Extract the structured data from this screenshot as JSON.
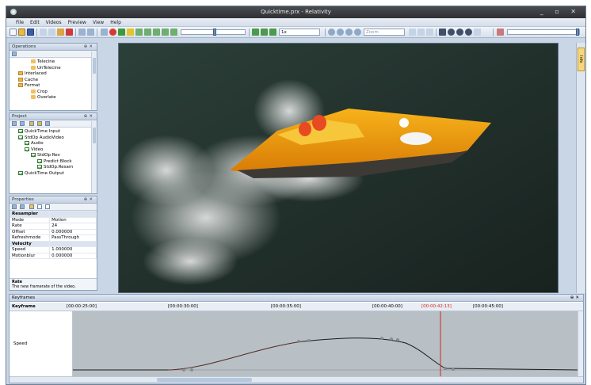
{
  "window": {
    "title": "Quicktime.prx - Relativity"
  },
  "menu": [
    "File",
    "Edit",
    "Videos",
    "Preview",
    "View",
    "Help"
  ],
  "toolbar": {
    "frame_field": "1x",
    "zoom_field": "Zoom"
  },
  "operations_panel": {
    "title": "Operations",
    "items": [
      {
        "label": "Telecine",
        "indent": 3
      },
      {
        "label": "UnTelecine",
        "indent": 3
      },
      {
        "label": "Interlaced",
        "indent": 1
      },
      {
        "label": "Cache",
        "indent": 1
      },
      {
        "label": "Format",
        "indent": 1
      },
      {
        "label": "Crop",
        "indent": 3
      },
      {
        "label": "Overlate",
        "indent": 3
      }
    ]
  },
  "project_panel": {
    "title": "Project",
    "items": [
      {
        "label": "QuickTime Input",
        "indent": 1
      },
      {
        "label": "StdOp AudioVideo",
        "indent": 1
      },
      {
        "label": "Audio",
        "indent": 2
      },
      {
        "label": "Video",
        "indent": 2
      },
      {
        "label": "StdOp Rev",
        "indent": 3
      },
      {
        "label": "Predict Block",
        "indent": 4
      },
      {
        "label": "StdOp.Resam",
        "indent": 4
      },
      {
        "label": "QuickTime Output",
        "indent": 1
      }
    ]
  },
  "properties_panel": {
    "title": "Properties",
    "rows": [
      {
        "type": "cat",
        "name": "Resampler",
        "value": ""
      },
      {
        "type": "row",
        "name": "Mode",
        "value": "Motion"
      },
      {
        "type": "sel",
        "name": "Rate",
        "value": "24"
      },
      {
        "type": "row",
        "name": "Offset",
        "value": "0.000000"
      },
      {
        "type": "row",
        "name": "Refreshmode",
        "value": "PassThrough"
      },
      {
        "type": "cat",
        "name": "Velocity",
        "value": ""
      },
      {
        "type": "row",
        "name": "Speed",
        "value": "1.000000"
      },
      {
        "type": "row",
        "name": "Motionblur",
        "value": "0.000000"
      }
    ],
    "desc_title": "Rate",
    "desc_text": "The new framerate of the video."
  },
  "right_strip": {
    "tab": "Info"
  },
  "keyframes": {
    "title": "Keyframes",
    "column_label": "Keyframe",
    "row_label": "Speed",
    "ticks": [
      {
        "label": "[00:00:25:00]",
        "current": false
      },
      {
        "label": "[00:00:30:00]",
        "current": false
      },
      {
        "label": "[00:00:35:00]",
        "current": false
      },
      {
        "label": "[00:00:40:00]",
        "current": false
      },
      {
        "label": "[00:00:42:13]",
        "current": true
      },
      {
        "label": "[00:00:45:00]",
        "current": false
      }
    ]
  },
  "colors": {
    "accent": "#d0281c",
    "panel_bg": "#c9d6e6"
  }
}
